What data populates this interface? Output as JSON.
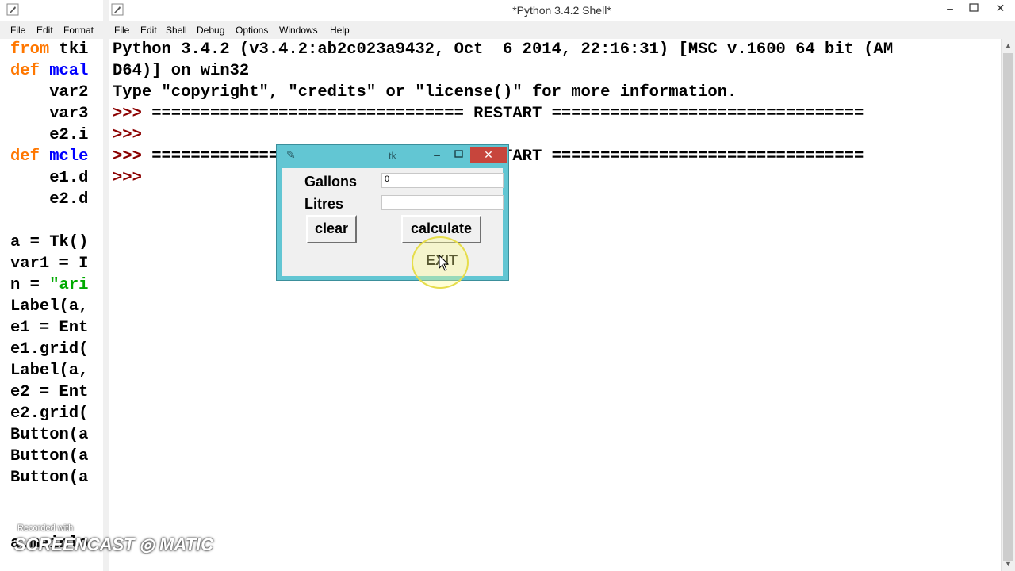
{
  "left_window": {
    "menu": [
      "File",
      "Edit",
      "Format"
    ],
    "code_lines": [
      [
        {
          "t": "from",
          "c": "kw-orange"
        },
        {
          "t": " tki",
          "c": ""
        }
      ],
      [
        {
          "t": "def",
          "c": "kw-orange"
        },
        {
          "t": " mcal",
          "c": "kw-blue"
        }
      ],
      [
        {
          "t": "    var2",
          "c": ""
        }
      ],
      [
        {
          "t": "    var3",
          "c": ""
        }
      ],
      [
        {
          "t": "    e2.i",
          "c": ""
        }
      ],
      [
        {
          "t": "def",
          "c": "kw-orange"
        },
        {
          "t": " mcle",
          "c": "kw-blue"
        }
      ],
      [
        {
          "t": "    e1.d",
          "c": ""
        }
      ],
      [
        {
          "t": "    e2.d",
          "c": ""
        }
      ],
      [
        {
          "t": "",
          "c": ""
        }
      ],
      [
        {
          "t": "a = Tk()",
          "c": ""
        }
      ],
      [
        {
          "t": "var1 = I",
          "c": ""
        }
      ],
      [
        {
          "t": "n = ",
          "c": ""
        },
        {
          "t": "\"ari",
          "c": "str-green"
        }
      ],
      [
        {
          "t": "Label(a,",
          "c": ""
        }
      ],
      [
        {
          "t": "e1 = Ent",
          "c": ""
        }
      ],
      [
        {
          "t": "e1.grid(",
          "c": ""
        }
      ],
      [
        {
          "t": "Label(a,",
          "c": ""
        }
      ],
      [
        {
          "t": "e2 = Ent",
          "c": ""
        }
      ],
      [
        {
          "t": "e2.grid(",
          "c": ""
        }
      ],
      [
        {
          "t": "Button(a",
          "c": ""
        }
      ],
      [
        {
          "t": "Button(a",
          "c": ""
        }
      ],
      [
        {
          "t": "Button(a",
          "c": ""
        }
      ]
    ],
    "bottom_line": "a.mainlo"
  },
  "shell_window": {
    "title": "*Python 3.4.2 Shell*",
    "menu": [
      "File",
      "Edit",
      "Shell",
      "Debug",
      "Options",
      "Windows",
      "Help"
    ],
    "lines": [
      "Python 3.4.2 (v3.4.2:ab2c023a9432, Oct  6 2014, 22:16:31) [MSC v.1600 64 bit (AM",
      "D64)] on win32",
      "Type \"copyright\", \"credits\" or \"license()\" for more information.",
      ">>> ================================ RESTART ================================",
      ">>> ",
      ">>> ================================ RESTART ================================",
      ">>> "
    ]
  },
  "tk_dialog": {
    "title": "tk",
    "close_glyph": "✕",
    "gallons_label": "Gallons",
    "gallons_value": "0",
    "litres_label": "Litres",
    "litres_value": "",
    "clear_label": "clear",
    "calculate_label": "calculate",
    "exit_label": "EXIT"
  },
  "watermark": {
    "small": "Recorded with",
    "big": "SCREENCAST ◎ MATIC"
  }
}
